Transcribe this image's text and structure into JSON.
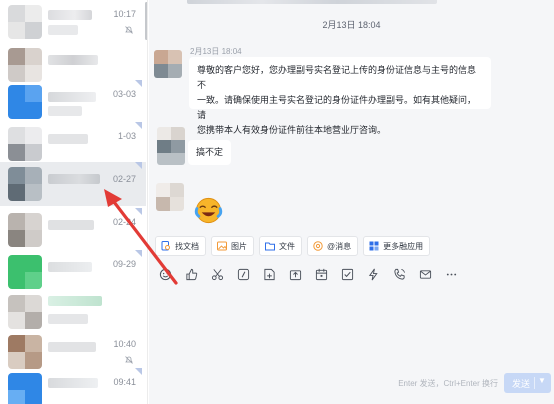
{
  "sidebar": {
    "conversations": [
      {
        "time": "10:17",
        "muted": true
      },
      {
        "time": "",
        "muted": false
      },
      {
        "time": "03-03",
        "muted": false
      },
      {
        "time": "1-03",
        "muted": false
      },
      {
        "time": "02-27",
        "muted": false,
        "active": true
      },
      {
        "time": "02-24",
        "muted": false
      },
      {
        "time": "09-29",
        "muted": false
      },
      {
        "time": "",
        "muted": false
      },
      {
        "time": "10:40",
        "muted": true
      },
      {
        "time": "09:41",
        "muted": false
      }
    ]
  },
  "chat": {
    "date_divider": "2月13日 18:04",
    "messages": [
      {
        "meta": "2月13日 18:04",
        "text_line1": "尊敬的客户您好，您办理副号实名登记上传的身份证信息与主号的信息不",
        "text_line2": "一致。请确保使用主号实名登记的身份证件办理副号。如有其他疑问，请",
        "text_line3": "您携带本人有效身份证件前往本地营业厅咨询。"
      },
      {
        "text": "搞不定"
      },
      {
        "emoji": "crying-laughing-emoji"
      }
    ],
    "quick_actions": [
      {
        "label": "找文档",
        "icon": "document-search-icon"
      },
      {
        "label": "图片",
        "icon": "image-icon"
      },
      {
        "label": "文件",
        "icon": "folder-icon"
      },
      {
        "label": "@消息",
        "icon": "at-icon"
      },
      {
        "label": "更多融应用",
        "icon": "apps-icon"
      }
    ],
    "toolbar_icons": [
      "emoji-icon",
      "thumbs-up-icon",
      "scissors-icon",
      "slash-command-icon",
      "add-note-icon",
      "upload-icon",
      "calendar-icon",
      "task-check-icon",
      "lightning-icon",
      "voice-call-icon",
      "mail-icon",
      "more-icon"
    ],
    "send_hint": "Enter 发送，Ctrl+Enter 换行",
    "send_label": "发送"
  },
  "colors": {
    "accent": "#2f6fe8",
    "annotation_arrow": "#e23b36",
    "send_button": "#c7d8f6"
  }
}
